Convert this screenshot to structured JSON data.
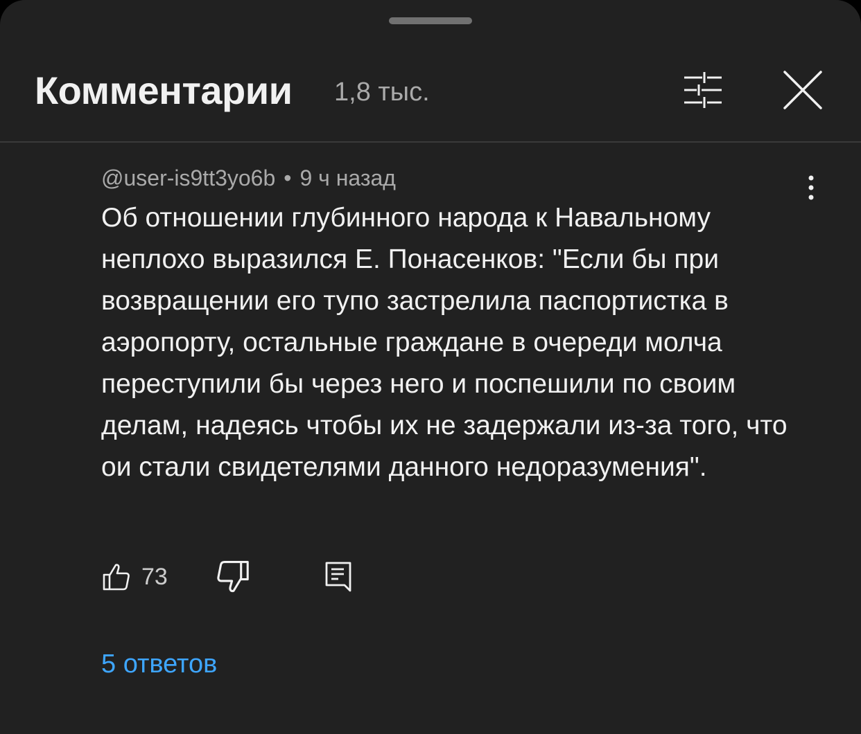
{
  "header": {
    "title": "Комментарии",
    "count": "1,8 тыс."
  },
  "icons": {
    "filter": "sliders-icon",
    "close": "close-icon",
    "more": "more-vertical-icon",
    "like": "thumbs-up-icon",
    "dislike": "thumbs-down-icon",
    "reply": "reply-icon"
  },
  "comment": {
    "author": "@user-is9tt3yo6b",
    "separator": "•",
    "time": "9 ч назад",
    "text": "Об отношении глубинного народа к Навальному неплохо выразился Е. Понасенков: \"Если бы при возвращении его тупо застрелила паспортистка в аэропорту, остальные граждане в очереди молча переступили бы через него и поспешили по своим делам, надеясь чтобы их не задержали из-за того, что ои стали свидетелями данного недоразумения\".",
    "likes": "73",
    "replies_label": "5 ответов"
  },
  "colors": {
    "background": "#212121",
    "text_primary": "#f1f1f1",
    "text_secondary": "#aaaaaa",
    "link": "#3ea6ff"
  }
}
